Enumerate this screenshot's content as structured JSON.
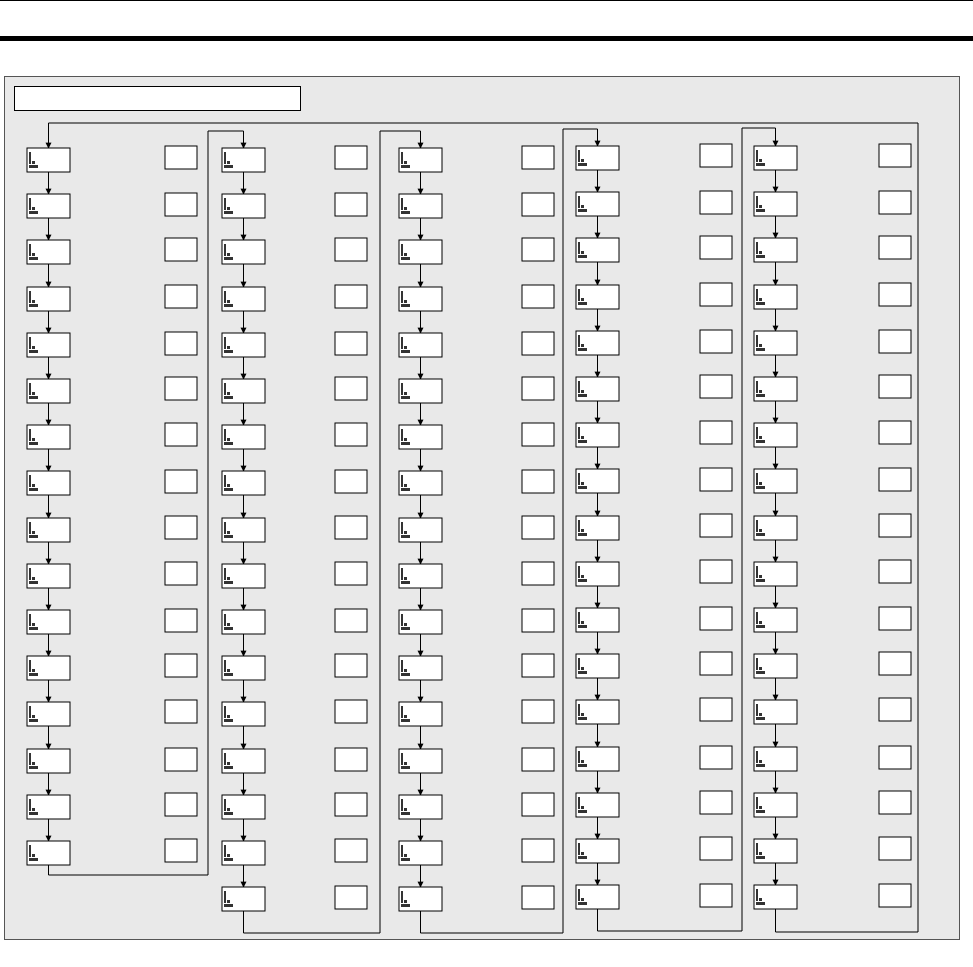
{
  "diagram": {
    "title_box_text": "",
    "columns": [
      {
        "screens": 16,
        "values": 16
      },
      {
        "screens": 17,
        "values": 17
      },
      {
        "screens": 17,
        "values": 17
      },
      {
        "screens": 17,
        "values": 17
      },
      {
        "screens": 17,
        "values": 17
      }
    ],
    "colors": {
      "panel": "#e9e9e9",
      "line": "#000000",
      "box": "#ffffff"
    }
  }
}
